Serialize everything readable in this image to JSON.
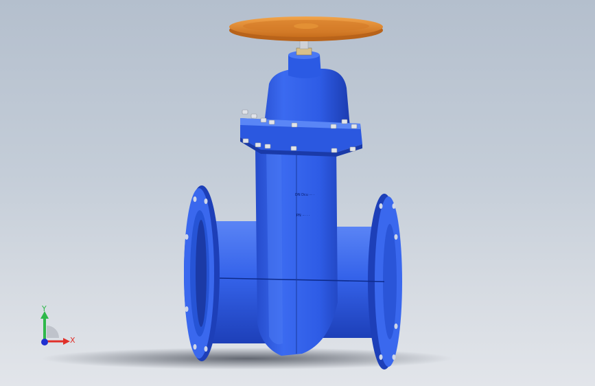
{
  "app": {
    "view": "3D viewport",
    "model": "gate valve"
  },
  "colors": {
    "background_top": "#b4bfcd",
    "background_bottom": "#e2e5ea",
    "body_blue": "#2f5fe6",
    "body_dark": "#1c3fb2",
    "body_light": "#4f7cf5",
    "handwheel_orange": "#e0872c",
    "stem_gray": "#cfd2d8",
    "bolt": "#d9dce2",
    "axis_x": "#e0302a",
    "axis_y": "#2eb84a",
    "axis_z": "#2030d0"
  },
  "triad": {
    "x_label": "X",
    "y_label": "Y"
  },
  "engraving": {
    "line1": "DN Dcu ··· ·",
    "line2": "PN ··· ·  ·"
  }
}
